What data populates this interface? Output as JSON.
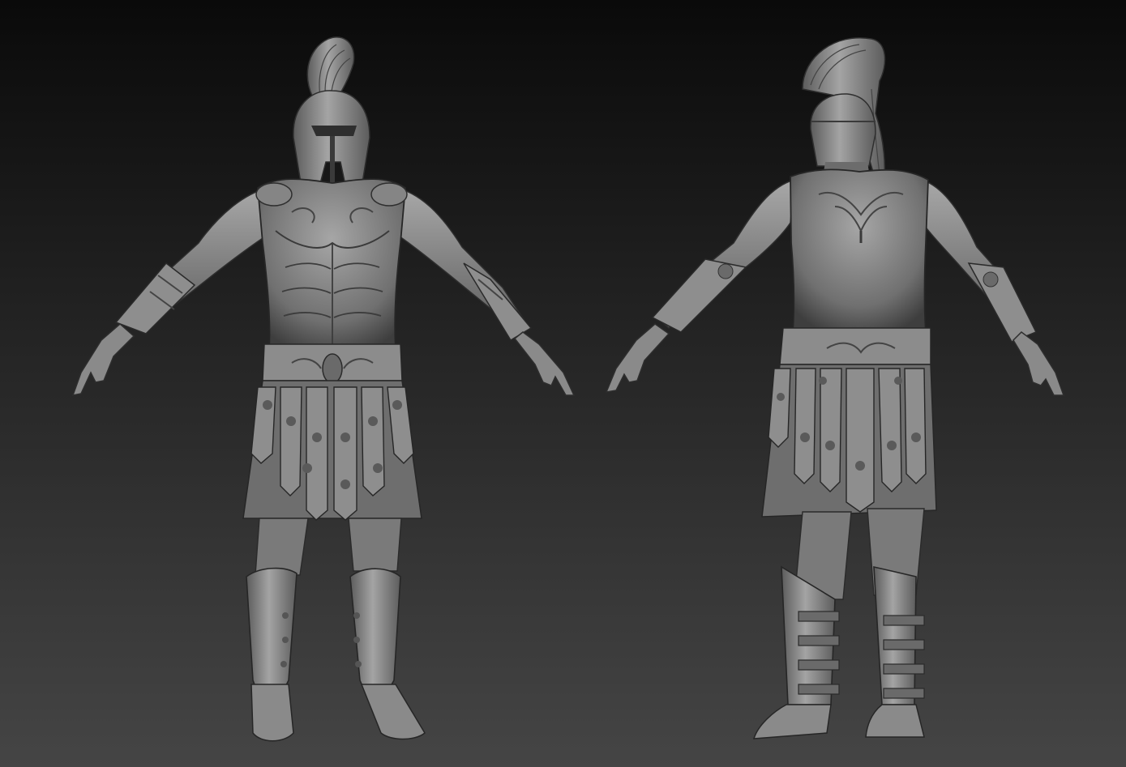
{
  "scene": {
    "background_top": "#0a0a0a",
    "background_bottom": "#454545",
    "clay_light": "#a9a9a9",
    "clay_mid": "#7c7c7c",
    "clay_dark": "#3c3c3c",
    "clay_shadow": "#262626"
  },
  "figures": [
    {
      "view": "front",
      "subject": "greek-hoplite-warrior"
    },
    {
      "view": "back",
      "subject": "greek-hoplite-warrior"
    }
  ]
}
